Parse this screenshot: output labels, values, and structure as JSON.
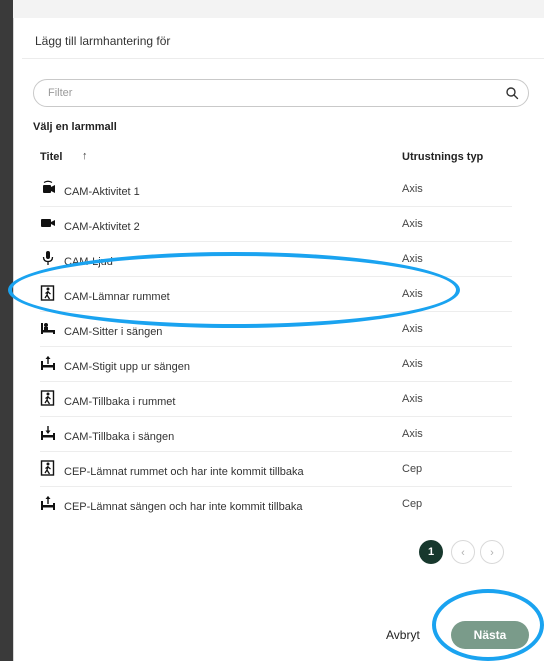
{
  "dialog": {
    "title": "Lägg till larmhantering för",
    "filter_placeholder": "Filter",
    "section_label": "Välj en larmmall"
  },
  "table": {
    "columns": {
      "title": "Titel",
      "sort_arrow": "↑",
      "type": "Utrustnings typ"
    },
    "rows": [
      {
        "icon": "camera-activity-icon",
        "name": "CAM-Aktivitet 1",
        "type": "Axis"
      },
      {
        "icon": "video-camera-icon",
        "name": "CAM-Aktivitet 2",
        "type": "Axis"
      },
      {
        "icon": "microphone-icon",
        "name": "CAM-Ljud",
        "type": "Axis"
      },
      {
        "icon": "exit-room-icon",
        "name": "CAM-Lämnar rummet",
        "type": "Axis"
      },
      {
        "icon": "sitting-in-bed-icon",
        "name": "CAM-Sitter i sängen",
        "type": "Axis"
      },
      {
        "icon": "out-of-bed-icon",
        "name": "CAM-Stigit upp ur sängen",
        "type": "Axis"
      },
      {
        "icon": "exit-room-icon",
        "name": "CAM-Tillbaka i rummet",
        "type": "Axis"
      },
      {
        "icon": "back-in-bed-icon",
        "name": "CAM-Tillbaka i sängen",
        "type": "Axis"
      },
      {
        "icon": "exit-room-icon",
        "name": "CEP-Lämnat rummet och har inte kommit tillbaka",
        "type": "Cep"
      },
      {
        "icon": "out-of-bed-icon",
        "name": "CEP-Lämnat sängen och har inte kommit tillbaka",
        "type": "Cep"
      }
    ]
  },
  "pagination": {
    "current": "1",
    "prev": "‹",
    "next": "›"
  },
  "footer": {
    "cancel": "Avbryt",
    "next": "Nästa"
  },
  "colors": {
    "primary_dark": "#17382d",
    "next_button": "#7a9b8a",
    "annotation": "#1aa3f0"
  }
}
